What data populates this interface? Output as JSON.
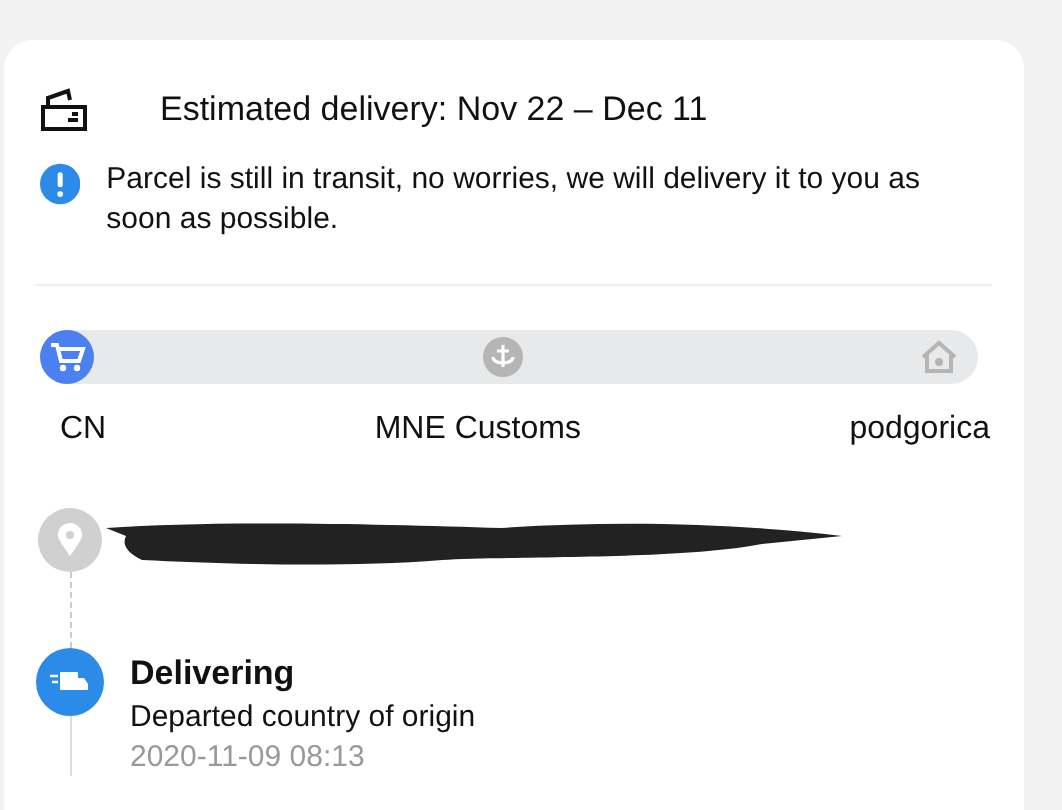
{
  "estimate": {
    "text": "Estimated delivery: Nov 22 – Dec 11"
  },
  "notice": {
    "text": "Parcel is still in transit, no worries, we will delivery it to you as soon as possible."
  },
  "route": {
    "stops": [
      {
        "kind": "cart",
        "label": "CN",
        "reached": true
      },
      {
        "kind": "anchor",
        "label": "MNE Customs",
        "reached": false
      },
      {
        "kind": "home",
        "label": "podgorica",
        "reached": false
      }
    ]
  },
  "events": [
    {
      "kind": "redacted",
      "active": false
    },
    {
      "kind": "status",
      "active": true,
      "title": "Delivering",
      "description": "Departed country of origin",
      "time": "2020-11-09 08:13"
    }
  ]
}
